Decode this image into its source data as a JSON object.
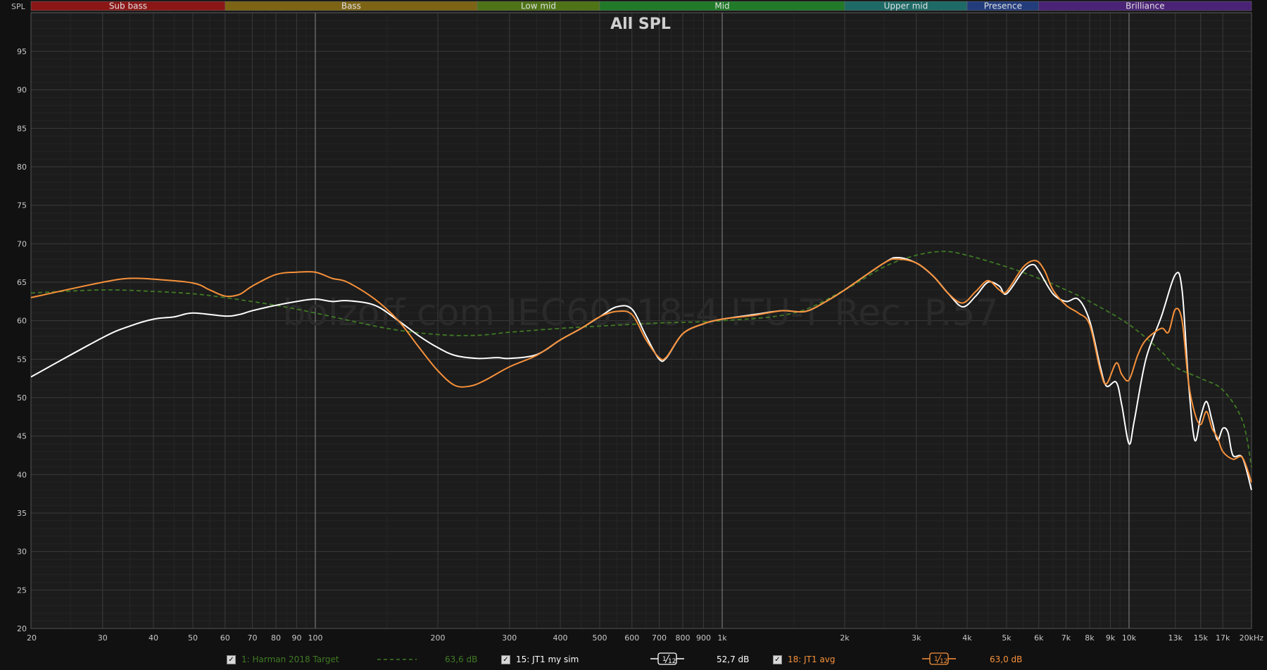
{
  "chart_data": {
    "type": "line",
    "title": "All SPL",
    "ylabel": "SPL",
    "xunit": "kHz",
    "watermark": "bolzoff.com IEC60318-4 ITU-T Rec. P.57",
    "xscale": "log",
    "xlim": [
      20,
      20000
    ],
    "ylim": [
      20,
      100
    ],
    "grid": true,
    "yticks": [
      20,
      25,
      30,
      35,
      40,
      45,
      50,
      55,
      60,
      65,
      70,
      75,
      80,
      85,
      90,
      95
    ],
    "xticks": [
      {
        "v": 20,
        "label": "20"
      },
      {
        "v": 30,
        "label": "30"
      },
      {
        "v": 40,
        "label": "40"
      },
      {
        "v": 50,
        "label": "50"
      },
      {
        "v": 60,
        "label": "60"
      },
      {
        "v": 70,
        "label": "70"
      },
      {
        "v": 80,
        "label": "80"
      },
      {
        "v": 90,
        "label": "90"
      },
      {
        "v": 100,
        "label": "100"
      },
      {
        "v": 200,
        "label": "200"
      },
      {
        "v": 300,
        "label": "300"
      },
      {
        "v": 400,
        "label": "400"
      },
      {
        "v": 500,
        "label": "500"
      },
      {
        "v": 600,
        "label": "600"
      },
      {
        "v": 700,
        "label": "700"
      },
      {
        "v": 800,
        "label": "800"
      },
      {
        "v": 900,
        "label": "900"
      },
      {
        "v": 1000,
        "label": "1k"
      },
      {
        "v": 2000,
        "label": "2k"
      },
      {
        "v": 3000,
        "label": "3k"
      },
      {
        "v": 4000,
        "label": "4k"
      },
      {
        "v": 5000,
        "label": "5k"
      },
      {
        "v": 6000,
        "label": "6k"
      },
      {
        "v": 7000,
        "label": "7k"
      },
      {
        "v": 8000,
        "label": "8k"
      },
      {
        "v": 9000,
        "label": "9k"
      },
      {
        "v": 10000,
        "label": "10k"
      },
      {
        "v": 13000,
        "label": "13k"
      },
      {
        "v": 15000,
        "label": "15k"
      },
      {
        "v": 17000,
        "label": "17k"
      },
      {
        "v": 20000,
        "label": "20kHz"
      }
    ],
    "bands": [
      {
        "name": "Sub bass",
        "from": 20,
        "to": 60,
        "color": "#8b1616"
      },
      {
        "name": "Bass",
        "from": 60,
        "to": 250,
        "color": "#7d6414"
      },
      {
        "name": "Low mid",
        "from": 250,
        "to": 500,
        "color": "#4e7416"
      },
      {
        "name": "Mid",
        "from": 500,
        "to": 2000,
        "color": "#207a28"
      },
      {
        "name": "Upper mid",
        "from": 2000,
        "to": 4000,
        "color": "#1e6a66"
      },
      {
        "name": "Presence",
        "from": 4000,
        "to": 6000,
        "color": "#223c7c"
      },
      {
        "name": "Brilliance",
        "from": 6000,
        "to": 20000,
        "color": "#4a2276"
      }
    ],
    "series": [
      {
        "name": "1: Harman 2018 Target",
        "color": "#3f7a24",
        "dash": true,
        "level": "63,6 dB",
        "points": [
          [
            20,
            63.6
          ],
          [
            30,
            64
          ],
          [
            40,
            63.8
          ],
          [
            50,
            63.5
          ],
          [
            60,
            63
          ],
          [
            80,
            62
          ],
          [
            100,
            61
          ],
          [
            150,
            59
          ],
          [
            200,
            58.2
          ],
          [
            250,
            58.1
          ],
          [
            300,
            58.5
          ],
          [
            400,
            59
          ],
          [
            500,
            59.3
          ],
          [
            700,
            59.7
          ],
          [
            1000,
            60
          ],
          [
            1500,
            61
          ],
          [
            2000,
            64
          ],
          [
            2500,
            67
          ],
          [
            3000,
            68.5
          ],
          [
            3500,
            69
          ],
          [
            4000,
            68.5
          ],
          [
            5000,
            67
          ],
          [
            6000,
            65.5
          ],
          [
            7000,
            64
          ],
          [
            8000,
            62.5
          ],
          [
            10000,
            59.5
          ],
          [
            12000,
            56
          ],
          [
            13000,
            54
          ],
          [
            15000,
            52.5
          ],
          [
            17000,
            51
          ],
          [
            19000,
            47
          ],
          [
            20000,
            41
          ]
        ]
      },
      {
        "name": "15: JT1 my sim",
        "color": "#ffffff",
        "dash": false,
        "smoothing": "1/12",
        "level": "52,7 dB",
        "points": [
          [
            20,
            52.7
          ],
          [
            30,
            57.8
          ],
          [
            35,
            59.3
          ],
          [
            40,
            60.2
          ],
          [
            45,
            60.5
          ],
          [
            50,
            61
          ],
          [
            60,
            60.6
          ],
          [
            65,
            60.8
          ],
          [
            70,
            61.3
          ],
          [
            80,
            62
          ],
          [
            90,
            62.5
          ],
          [
            100,
            62.8
          ],
          [
            110,
            62.5
          ],
          [
            120,
            62.6
          ],
          [
            140,
            62
          ],
          [
            160,
            60
          ],
          [
            180,
            58
          ],
          [
            200,
            56.5
          ],
          [
            220,
            55.5
          ],
          [
            250,
            55.1
          ],
          [
            280,
            55.2
          ],
          [
            300,
            55.1
          ],
          [
            350,
            55.6
          ],
          [
            400,
            57.5
          ],
          [
            450,
            59
          ],
          [
            500,
            60.5
          ],
          [
            550,
            61.8
          ],
          [
            600,
            61.5
          ],
          [
            650,
            58
          ],
          [
            700,
            55
          ],
          [
            730,
            55.2
          ],
          [
            800,
            58.3
          ],
          [
            900,
            59.6
          ],
          [
            1000,
            60.2
          ],
          [
            1200,
            60.8
          ],
          [
            1400,
            61.3
          ],
          [
            1600,
            61.2
          ],
          [
            1800,
            62.5
          ],
          [
            2000,
            64
          ],
          [
            2500,
            67.5
          ],
          [
            2700,
            68.2
          ],
          [
            3000,
            67.5
          ],
          [
            3300,
            65.8
          ],
          [
            3600,
            63.5
          ],
          [
            3900,
            61.8
          ],
          [
            4200,
            63.2
          ],
          [
            4500,
            65
          ],
          [
            4800,
            64.5
          ],
          [
            5000,
            63.5
          ],
          [
            5500,
            66.5
          ],
          [
            5800,
            67.3
          ],
          [
            6000,
            66.5
          ],
          [
            6500,
            63.5
          ],
          [
            7000,
            62.5
          ],
          [
            7500,
            62.8
          ],
          [
            8000,
            60
          ],
          [
            8500,
            54
          ],
          [
            8800,
            51.5
          ],
          [
            9300,
            52
          ],
          [
            9600,
            49
          ],
          [
            10000,
            44
          ],
          [
            10300,
            47
          ],
          [
            11000,
            55
          ],
          [
            12000,
            60.5
          ],
          [
            13000,
            66
          ],
          [
            13500,
            64
          ],
          [
            14000,
            52
          ],
          [
            14500,
            44.5
          ],
          [
            15000,
            47.5
          ],
          [
            15500,
            49.5
          ],
          [
            16000,
            47
          ],
          [
            16500,
            44.5
          ],
          [
            17000,
            46
          ],
          [
            17500,
            45.5
          ],
          [
            18000,
            42.5
          ],
          [
            19000,
            42.2
          ],
          [
            20000,
            38
          ]
        ]
      },
      {
        "name": "18: JT1 avg",
        "color": "#f7913a",
        "dash": false,
        "smoothing": "1/12",
        "level": "63,0 dB",
        "points": [
          [
            20,
            63
          ],
          [
            30,
            65
          ],
          [
            35,
            65.5
          ],
          [
            40,
            65.4
          ],
          [
            50,
            64.9
          ],
          [
            55,
            64
          ],
          [
            60,
            63.2
          ],
          [
            65,
            63.4
          ],
          [
            70,
            64.5
          ],
          [
            80,
            66
          ],
          [
            90,
            66.3
          ],
          [
            100,
            66.3
          ],
          [
            110,
            65.5
          ],
          [
            120,
            65
          ],
          [
            140,
            62.8
          ],
          [
            160,
            60
          ],
          [
            180,
            56.5
          ],
          [
            200,
            53.5
          ],
          [
            220,
            51.6
          ],
          [
            240,
            51.5
          ],
          [
            260,
            52.2
          ],
          [
            300,
            54
          ],
          [
            350,
            55.5
          ],
          [
            400,
            57.5
          ],
          [
            450,
            59
          ],
          [
            500,
            60.5
          ],
          [
            550,
            61.2
          ],
          [
            600,
            60.8
          ],
          [
            650,
            57.5
          ],
          [
            700,
            55.2
          ],
          [
            730,
            55.3
          ],
          [
            800,
            58.3
          ],
          [
            900,
            59.6
          ],
          [
            1000,
            60.2
          ],
          [
            1200,
            60.7
          ],
          [
            1400,
            61.3
          ],
          [
            1600,
            61.2
          ],
          [
            1800,
            62.5
          ],
          [
            2000,
            64
          ],
          [
            2500,
            67.5
          ],
          [
            2700,
            68
          ],
          [
            3000,
            67.5
          ],
          [
            3300,
            65.8
          ],
          [
            3600,
            63.5
          ],
          [
            3900,
            62.3
          ],
          [
            4200,
            63.8
          ],
          [
            4500,
            65.2
          ],
          [
            4800,
            64
          ],
          [
            5000,
            63.8
          ],
          [
            5500,
            67
          ],
          [
            5900,
            67.8
          ],
          [
            6200,
            66.5
          ],
          [
            6500,
            64
          ],
          [
            7000,
            62
          ],
          [
            7500,
            61
          ],
          [
            8000,
            59.5
          ],
          [
            8500,
            53.5
          ],
          [
            8800,
            51.8
          ],
          [
            9300,
            54.5
          ],
          [
            9600,
            53
          ],
          [
            10000,
            52.3
          ],
          [
            10500,
            55.5
          ],
          [
            11000,
            57.5
          ],
          [
            12000,
            59
          ],
          [
            12500,
            58.5
          ],
          [
            13000,
            61.5
          ],
          [
            13500,
            60
          ],
          [
            14000,
            52
          ],
          [
            14500,
            48
          ],
          [
            15000,
            46.5
          ],
          [
            15500,
            48.2
          ],
          [
            16000,
            46
          ],
          [
            16500,
            44.8
          ],
          [
            17000,
            43
          ],
          [
            18000,
            42
          ],
          [
            19000,
            42.2
          ],
          [
            20000,
            39
          ]
        ]
      }
    ]
  },
  "legend": {
    "smoothing_label_num": "1",
    "smoothing_label_den": "12"
  }
}
